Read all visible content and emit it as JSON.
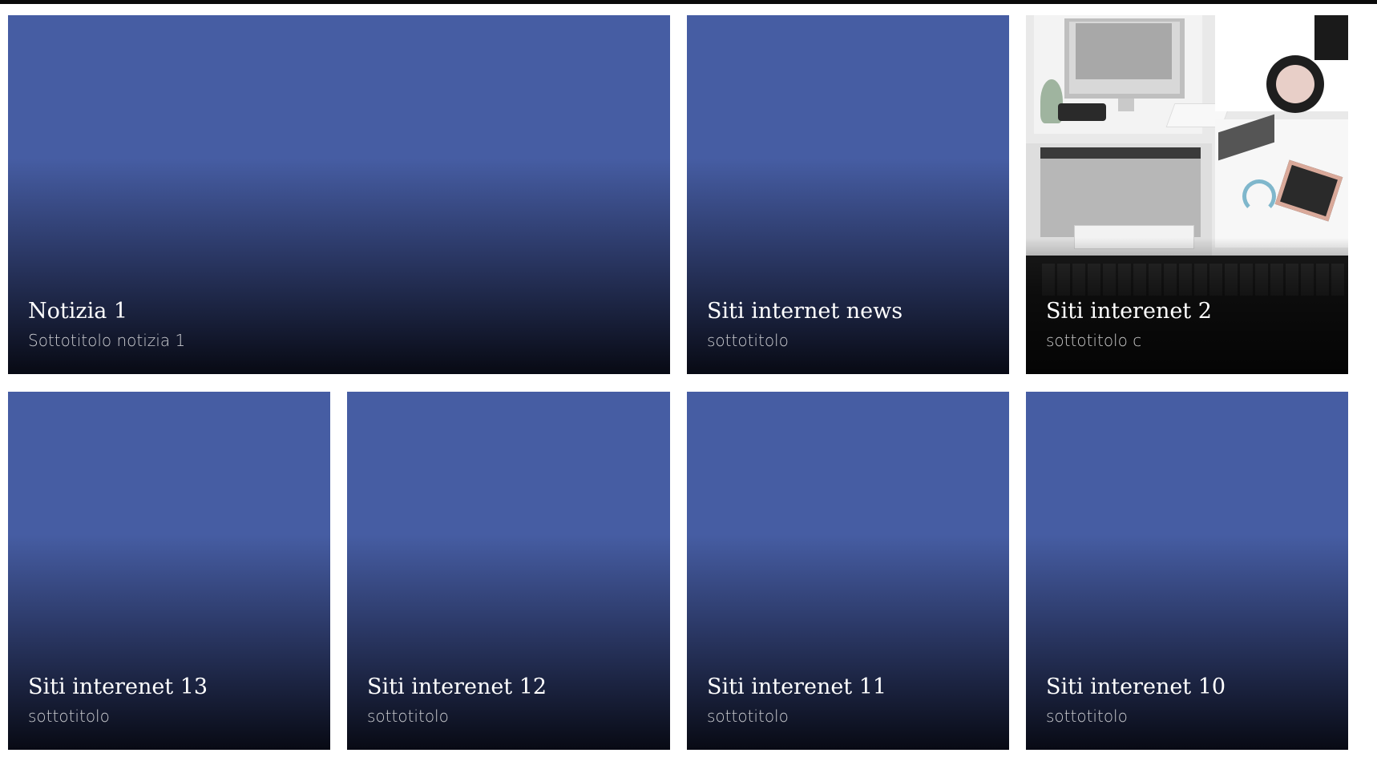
{
  "theme": {
    "card_color": "#465da3",
    "card_gradient_end": "#080a14",
    "title_color": "#ffffff",
    "subtitle_color": "#d0d0d0"
  },
  "cards": [
    {
      "title": "Notizia 1",
      "subtitle": "Sottotitolo notizia 1",
      "background": "solid-blue-gradient"
    },
    {
      "title": "Siti internet news",
      "subtitle": "sottotitolo",
      "background": "solid-blue-gradient"
    },
    {
      "title": "Siti interenet 2",
      "subtitle": "sottotitolo c",
      "background": "desk-photo-collage"
    },
    {
      "title": "Siti interenet 13",
      "subtitle": "sottotitolo",
      "background": "solid-blue-gradient"
    },
    {
      "title": "Siti interenet 12",
      "subtitle": "sottotitolo",
      "background": "solid-blue-gradient"
    },
    {
      "title": "Siti interenet 11",
      "subtitle": "sottotitolo",
      "background": "solid-blue-gradient"
    },
    {
      "title": "Siti interenet 10",
      "subtitle": "sottotitolo",
      "background": "solid-blue-gradient"
    }
  ],
  "photo_card_icons": [
    "imac-image",
    "coffee-cup-image",
    "keyboard-image",
    "headphones-image",
    "chalkboard-image"
  ]
}
